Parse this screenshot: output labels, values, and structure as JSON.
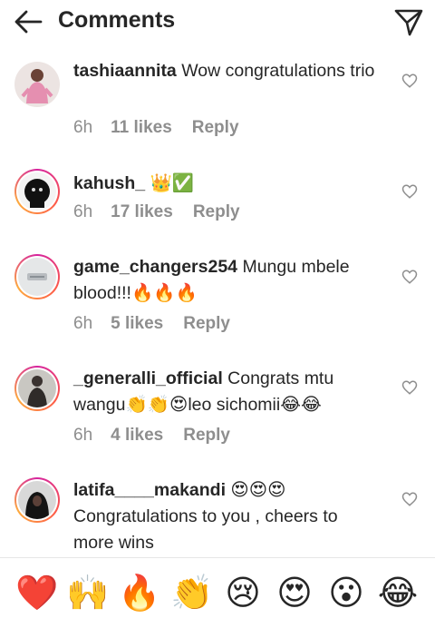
{
  "header": {
    "title": "Comments",
    "back_icon": "arrow-left-icon",
    "share_icon": "paper-plane-icon"
  },
  "comments": [
    {
      "username": "tashiaannita",
      "text": " Wow congratulations trio",
      "time": "6h",
      "likes": "11 likes",
      "reply": "Reply"
    },
    {
      "username": "kahush_",
      "text": " 👑✅",
      "time": "6h",
      "likes": "17 likes",
      "reply": "Reply"
    },
    {
      "username": "game_changers254",
      "text": " Mungu mbele blood!!!🔥🔥🔥",
      "time": "6h",
      "likes": "5 likes",
      "reply": "Reply"
    },
    {
      "username": "_generalli_official",
      "text": " Congrats mtu wangu👏👏😍leo sichomii😂😂",
      "time": "6h",
      "likes": "4 likes",
      "reply": "Reply"
    },
    {
      "username": "latifa____makandi",
      "text": " 😍😍😍 Congratulations to you , cheers to more wins",
      "time": "",
      "likes": "",
      "reply": ""
    }
  ],
  "emoji_bar": [
    "❤️",
    "🙌",
    "🔥",
    "👏",
    "😢",
    "😍",
    "😮",
    "😂"
  ],
  "colors": {
    "story_ring": "#d6249f",
    "text": "#262626",
    "meta": "#8e8e8e"
  }
}
